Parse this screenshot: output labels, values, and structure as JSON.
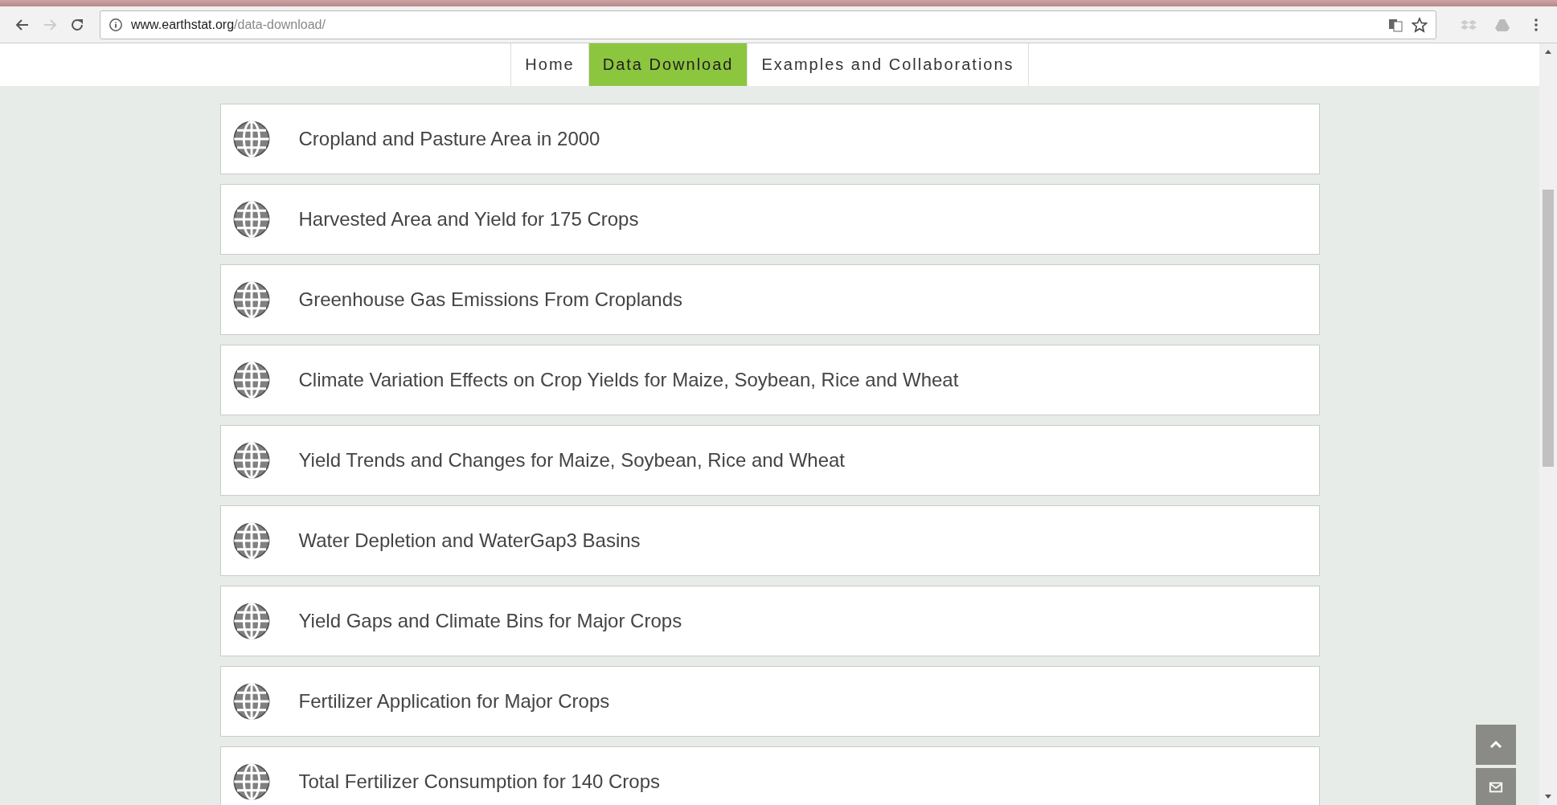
{
  "browser": {
    "url_host": "www.earthstat.org",
    "url_path": "/data-download/"
  },
  "nav": [
    {
      "label": "Home",
      "selected": false
    },
    {
      "label": "Data Download",
      "selected": true
    },
    {
      "label": "Examples and Collaborations",
      "selected": false
    }
  ],
  "datasets": [
    {
      "title": "Cropland and Pasture Area in 2000"
    },
    {
      "title": "Harvested Area and Yield for 175 Crops"
    },
    {
      "title": "Greenhouse Gas Emissions From Croplands"
    },
    {
      "title": "Climate Variation Effects on Crop Yields for Maize, Soybean, Rice and Wheat"
    },
    {
      "title": "Yield Trends and Changes for Maize, Soybean, Rice and Wheat"
    },
    {
      "title": "Water Depletion and WaterGap3 Basins"
    },
    {
      "title": "Yield Gaps and Climate Bins for Major Crops"
    },
    {
      "title": "Fertilizer Application for Major Crops"
    },
    {
      "title": "Total Fertilizer Consumption for 140 Crops"
    }
  ]
}
